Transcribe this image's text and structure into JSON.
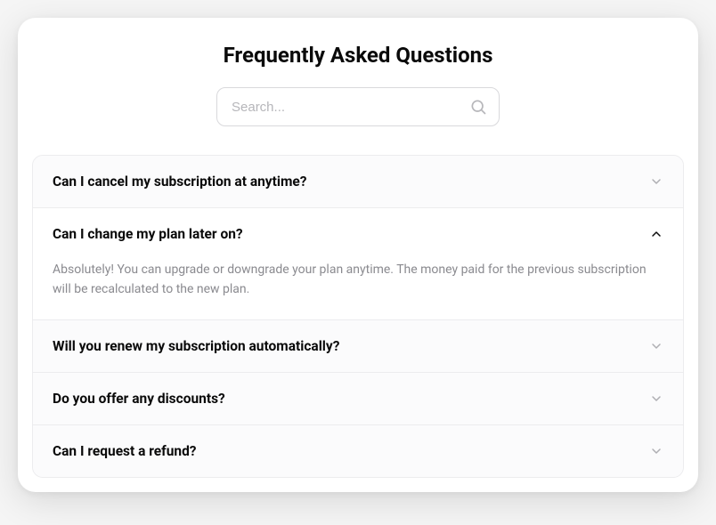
{
  "title": "Frequently Asked Questions",
  "search": {
    "placeholder": "Search..."
  },
  "faq": [
    {
      "question": "Can I cancel my subscription at anytime?",
      "answer": "",
      "expanded": false
    },
    {
      "question": "Can I change my plan later on?",
      "answer": "Absolutely! You can upgrade or downgrade your plan anytime. The money paid for the previous subscription will be recalculated to the new plan.",
      "expanded": true
    },
    {
      "question": "Will you renew my subscription automatically?",
      "answer": "",
      "expanded": false
    },
    {
      "question": "Do you offer any discounts?",
      "answer": "",
      "expanded": false
    },
    {
      "question": "Can I request a refund?",
      "answer": "",
      "expanded": false
    }
  ]
}
